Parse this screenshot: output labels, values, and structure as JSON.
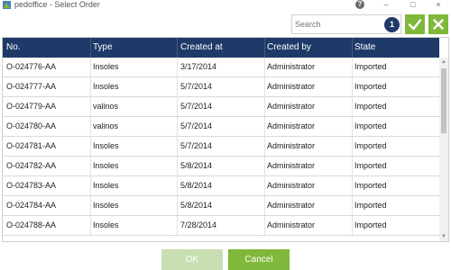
{
  "window": {
    "title": "pedoffice - Select Order",
    "minimize_glyph": "–",
    "maximize_glyph": "□",
    "close_glyph": "×",
    "help_glyph": "?"
  },
  "toolbar": {
    "search_placeholder": "Search",
    "search_value": "",
    "selected_count": "1"
  },
  "table": {
    "columns": [
      "No.",
      "Type",
      "Created at",
      "Created by",
      "State"
    ],
    "rows": [
      [
        "O-024776-AA",
        "Insoles",
        "3/17/2014",
        "Administrator",
        "Imported"
      ],
      [
        "O-024777-AA",
        "Insoles",
        "5/7/2014",
        "Administrator",
        "Imported"
      ],
      [
        "O-024779-AA",
        "valinos",
        "5/7/2014",
        "Administrator",
        "Imported"
      ],
      [
        "O-024780-AA",
        "valinos",
        "5/7/2014",
        "Administrator",
        "Imported"
      ],
      [
        "O-024781-AA",
        "Insoles",
        "5/7/2014",
        "Administrator",
        "Imported"
      ],
      [
        "O-024782-AA",
        "Insoles",
        "5/8/2014",
        "Administrator",
        "Imported"
      ],
      [
        "O-024783-AA",
        "Insoles",
        "5/8/2014",
        "Administrator",
        "Imported"
      ],
      [
        "O-024784-AA",
        "Insoles",
        "5/8/2014",
        "Administrator",
        "Imported"
      ],
      [
        "O-024788-AA",
        "Insoles",
        "7/28/2014",
        "Administrator",
        "Imported"
      ]
    ]
  },
  "buttons": {
    "ok_label": "OK",
    "cancel_label": "Cancel"
  },
  "colors": {
    "header_bg": "#1f3a68",
    "accent_green": "#7fb83a",
    "accent_green_disabled": "#c9dfb1"
  },
  "icons": {
    "app": "app-logo-icon",
    "help": "help-icon",
    "confirm": "checkmark-icon",
    "cancel": "close-x-icon"
  }
}
